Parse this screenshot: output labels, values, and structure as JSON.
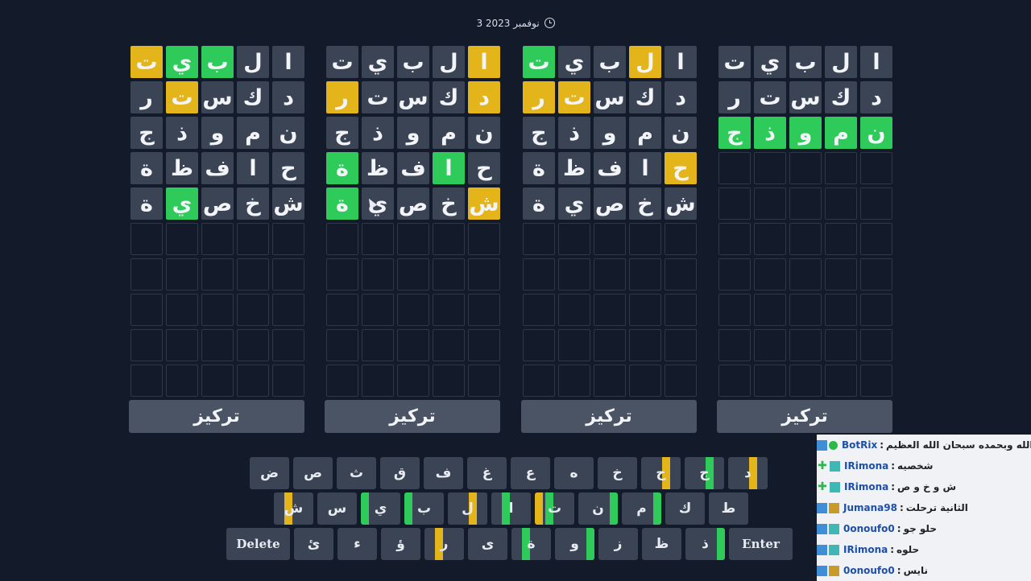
{
  "header": {
    "date": "3 نوفمبر 2023"
  },
  "focus_label": "تركيز",
  "boards": [
    {
      "rows": [
        [
          "ا:x",
          "ل:x",
          "ب:g",
          "ي:g",
          "ت:y"
        ],
        [
          "د:x",
          "ك:x",
          "س:x",
          "ت:y",
          "ر:x"
        ],
        [
          "ن:x",
          "م:x",
          "و:x",
          "ذ:x",
          "ج:x"
        ],
        [
          "ح:x",
          "ا:x",
          "ف:x",
          "ظ:x",
          "ة:x"
        ],
        [
          "ش:x",
          "خ:x",
          "ص:x",
          "ي:g",
          "ة:x"
        ],
        [
          ":e",
          ":e",
          ":e",
          ":e",
          ":e"
        ],
        [
          ":e",
          ":e",
          ":e",
          ":e",
          ":e"
        ],
        [
          ":e",
          ":e",
          ":e",
          ":e",
          ":e"
        ],
        [
          ":e",
          ":e",
          ":e",
          ":e",
          ":e"
        ],
        [
          ":e",
          ":e",
          ":e",
          ":e",
          ":e"
        ]
      ]
    },
    {
      "rows": [
        [
          "ا:y",
          "ل:x",
          "ب:x",
          "ي:x",
          "ت:x"
        ],
        [
          "د:y",
          "ك:x",
          "س:x",
          "ت:x",
          "ر:y"
        ],
        [
          "ن:x",
          "م:x",
          "و:x",
          "ذ:x",
          "ج:x"
        ],
        [
          "ح:x",
          "ا:g",
          "ف:x",
          "ظ:x",
          "ة:g"
        ],
        [
          "ش:y",
          "خ:x",
          "ص:x",
          "ي:x",
          "ة:g"
        ],
        [
          ":e",
          ":e",
          ":e",
          ":e",
          ":e"
        ],
        [
          ":e",
          ":e",
          ":e",
          ":e",
          ":e"
        ],
        [
          ":e",
          ":e",
          ":e",
          ":e",
          ":e"
        ],
        [
          ":e",
          ":e",
          ":e",
          ":e",
          ":e"
        ],
        [
          ":e",
          ":e",
          ":e",
          ":e",
          ":e"
        ]
      ]
    },
    {
      "rows": [
        [
          "ا:x",
          "ل:y",
          "ب:x",
          "ي:x",
          "ت:g"
        ],
        [
          "د:x",
          "ك:x",
          "س:x",
          "ت:y",
          "ر:y"
        ],
        [
          "ن:x",
          "م:x",
          "و:x",
          "ذ:x",
          "ج:x"
        ],
        [
          "ح:y",
          "ا:x",
          "ف:x",
          "ظ:x",
          "ة:x"
        ],
        [
          "ش:x",
          "خ:x",
          "ص:x",
          "ي:x",
          "ة:x"
        ],
        [
          ":e",
          ":e",
          ":e",
          ":e",
          ":e"
        ],
        [
          ":e",
          ":e",
          ":e",
          ":e",
          ":e"
        ],
        [
          ":e",
          ":e",
          ":e",
          ":e",
          ":e"
        ],
        [
          ":e",
          ":e",
          ":e",
          ":e",
          ":e"
        ],
        [
          ":e",
          ":e",
          ":e",
          ":e",
          ":e"
        ]
      ]
    },
    {
      "rows": [
        [
          "ا:x",
          "ل:x",
          "ب:x",
          "ي:x",
          "ت:x"
        ],
        [
          "د:x",
          "ك:x",
          "س:x",
          "ت:x",
          "ر:x"
        ],
        [
          "ن:g",
          "م:g",
          "و:g",
          "ذ:g",
          "ج:g"
        ],
        [
          ":e",
          ":e",
          ":e",
          ":e",
          ":e"
        ],
        [
          ":e",
          ":e",
          ":e",
          ":e",
          ":e"
        ],
        [
          ":e",
          ":e",
          ":e",
          ":e",
          ":e"
        ],
        [
          ":e",
          ":e",
          ":e",
          ":e",
          ":e"
        ],
        [
          ":e",
          ":e",
          ":e",
          ":e",
          ":e"
        ],
        [
          ":e",
          ":e",
          ":e",
          ":e",
          ":e"
        ],
        [
          ":e",
          ":e",
          ":e",
          ":e",
          ":e"
        ]
      ]
    }
  ],
  "keyboard": {
    "rows": [
      [
        {
          "k": "ض"
        },
        {
          "k": "ص"
        },
        {
          "k": "ث"
        },
        {
          "k": "ق"
        },
        {
          "k": "ف"
        },
        {
          "k": "غ"
        },
        {
          "k": "ع"
        },
        {
          "k": "ه"
        },
        {
          "k": "خ"
        },
        {
          "k": "ح",
          "bars": [
            [
              "y",
              "CR"
            ]
          ]
        },
        {
          "k": "ج",
          "bars": [
            [
              "g",
              "CR"
            ]
          ]
        },
        {
          "k": "د",
          "bars": [
            [
              "y",
              "CR"
            ]
          ]
        }
      ],
      [
        {
          "k": "ش",
          "bars": [
            [
              "y",
              "CL"
            ]
          ]
        },
        {
          "k": "س"
        },
        {
          "k": "ي",
          "bars": [
            [
              "g",
              "L"
            ]
          ]
        },
        {
          "k": "ب",
          "bars": [
            [
              "g",
              "L"
            ]
          ]
        },
        {
          "k": "ل",
          "bars": [
            [
              "y",
              "CR"
            ]
          ]
        },
        {
          "k": "ا",
          "bars": [
            [
              "g",
              "CL"
            ]
          ]
        },
        {
          "k": "ت",
          "bars": [
            [
              "y",
              "L"
            ],
            [
              "g",
              "CL"
            ]
          ]
        },
        {
          "k": "ن",
          "bars": [
            [
              "g",
              "R"
            ]
          ]
        },
        {
          "k": "م",
          "bars": [
            [
              "g",
              "R"
            ]
          ]
        },
        {
          "k": "ك"
        },
        {
          "k": "ط"
        }
      ],
      [
        {
          "k": "Delete",
          "wide": true
        },
        {
          "k": "ئ"
        },
        {
          "k": "ء"
        },
        {
          "k": "ؤ"
        },
        {
          "k": "ر",
          "bars": [
            [
              "y",
              "CL"
            ]
          ]
        },
        {
          "k": "ى"
        },
        {
          "k": "ة",
          "bars": [
            [
              "g",
              "CL"
            ]
          ]
        },
        {
          "k": "و",
          "bars": [
            [
              "g",
              "R"
            ]
          ]
        },
        {
          "k": "ز"
        },
        {
          "k": "ظ"
        },
        {
          "k": "ذ",
          "bars": [
            [
              "g",
              "R"
            ]
          ]
        },
        {
          "k": "Enter",
          "wide": true
        }
      ]
    ]
  },
  "chat": {
    "messages": [
      {
        "badges": [
          "star",
          "check"
        ],
        "user": "BotRix",
        "text": "سبحان الله وبحمده سبحان الله العظيم"
      },
      {
        "badges": [
          "plus",
          "badge"
        ],
        "user": "IRimona",
        "text": "شخصيه"
      },
      {
        "badges": [
          "plus",
          "badge"
        ],
        "user": "IRimona",
        "text": "ش و خ و ص"
      },
      {
        "badges": [
          "star",
          "bit"
        ],
        "user": "Jumana98",
        "text": "الثانية ترحلت"
      },
      {
        "badges": [
          "star",
          "badge"
        ],
        "user": "0onoufo0",
        "text": "حلو جو"
      },
      {
        "badges": [
          "star",
          "badge"
        ],
        "user": "IRimona",
        "text": "حلوه"
      },
      {
        "badges": [
          "star",
          "bit"
        ],
        "user": "0onoufo0",
        "text": "نايس"
      }
    ]
  }
}
